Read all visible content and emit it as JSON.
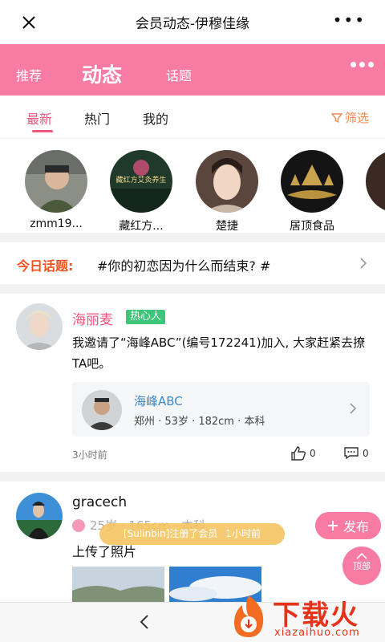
{
  "titlebar": {
    "title": "会员动态-伊穆佳缘",
    "more": "•••"
  },
  "top_tabs": [
    {
      "label": "推荐"
    },
    {
      "label": "动态"
    },
    {
      "label": "话题"
    }
  ],
  "sub_tabs": [
    {
      "label": "最新"
    },
    {
      "label": "热门"
    },
    {
      "label": "我的"
    }
  ],
  "filter_label": "筛选",
  "stories": [
    {
      "name": "zmm19..."
    },
    {
      "name": "藏红方..."
    },
    {
      "name": "楚捷"
    },
    {
      "name": "居顶食品"
    }
  ],
  "story2_overlay": "藏红方艾灸养生",
  "topic": {
    "label": "今日话题:",
    "text": "#你的初恋因为什么而结束? #"
  },
  "post1": {
    "user": "海丽麦",
    "badge": "热心人",
    "text": "我邀请了“海峰ABC”(编号172241)加入, 大家赶紧去撩TA吧。",
    "invite_name": "海峰ABC",
    "invite_meta": "郑州 · 53岁 · 182cm · 本科",
    "time": "3小时前",
    "likes": "0",
    "comments": "0"
  },
  "post2": {
    "user": "gracech",
    "meta": "25岁 · 165cm · 本科",
    "text": "上传了照片"
  },
  "toast": {
    "text": "[Sulinbin]注册了会员",
    "time": "1小时前"
  },
  "publish_label": "发布",
  "top_label": "顶部",
  "watermark": {
    "text": "下载火",
    "sub": "xiazaihuo.com"
  },
  "colors": {
    "brand_pink": "#f77ba3",
    "active_pink": "#f0567e",
    "topic_orange": "#f0531f",
    "badge_green": "#3dc57a",
    "link_blue": "#3b87c9"
  }
}
